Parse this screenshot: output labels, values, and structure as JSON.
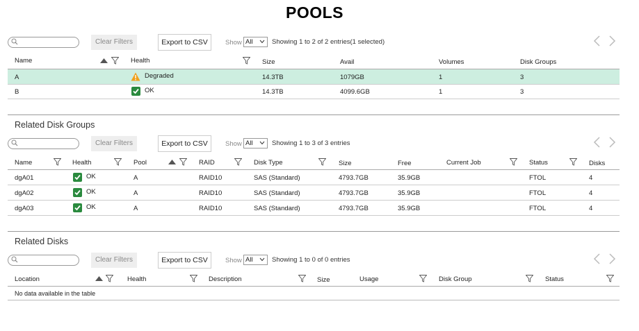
{
  "page": {
    "title": "POOLS"
  },
  "common": {
    "search_placeholder": "",
    "clear_filters": "Clear Filters",
    "export_csv": "Export to CSV",
    "show_label": "Show",
    "show_value": "All"
  },
  "pools": {
    "showing": "Showing 1 to 2 of 2 entries(1 selected)",
    "columns": [
      "Name",
      "Health",
      "Size",
      "Avail",
      "Volumes",
      "Disk Groups"
    ],
    "rows": [
      {
        "name": "A",
        "health": "Degraded",
        "health_icon": "warning-icon",
        "size": "14.3TB",
        "avail": "1079GB",
        "volumes": "1",
        "disk_groups": "3",
        "selected": true
      },
      {
        "name": "B",
        "health": "OK",
        "health_icon": "ok-check-icon",
        "size": "14.3TB",
        "avail": "4099.6GB",
        "volumes": "1",
        "disk_groups": "3",
        "selected": false
      }
    ]
  },
  "disk_groups": {
    "title": "Related Disk Groups",
    "showing": "Showing 1 to 3 of 3 entries",
    "columns": [
      "Name",
      "Health",
      "Pool",
      "RAID",
      "Disk Type",
      "Size",
      "Free",
      "Current Job",
      "Status",
      "Disks"
    ],
    "rows": [
      {
        "name": "dgA01",
        "health": "OK",
        "pool": "A",
        "raid": "RAID10",
        "disk_type": "SAS (Standard)",
        "size": "4793.7GB",
        "free": "35.9GB",
        "current_job": "",
        "status": "FTOL",
        "disks": "4"
      },
      {
        "name": "dgA02",
        "health": "OK",
        "pool": "A",
        "raid": "RAID10",
        "disk_type": "SAS (Standard)",
        "size": "4793.7GB",
        "free": "35.9GB",
        "current_job": "",
        "status": "FTOL",
        "disks": "4"
      },
      {
        "name": "dgA03",
        "health": "OK",
        "pool": "A",
        "raid": "RAID10",
        "disk_type": "SAS (Standard)",
        "size": "4793.7GB",
        "free": "35.9GB",
        "current_job": "",
        "status": "FTOL",
        "disks": "4"
      }
    ]
  },
  "disks": {
    "title": "Related Disks",
    "showing": "Showing 1 to 0 of 0 entries",
    "columns": [
      "Location",
      "Health",
      "Description",
      "Size",
      "Usage",
      "Disk Group",
      "Status"
    ],
    "empty": "No data available in the table"
  },
  "colors": {
    "selected_row": "#cdeee0",
    "ok_green": "#2a8a3e",
    "warning_orange": "#f0a01a"
  }
}
